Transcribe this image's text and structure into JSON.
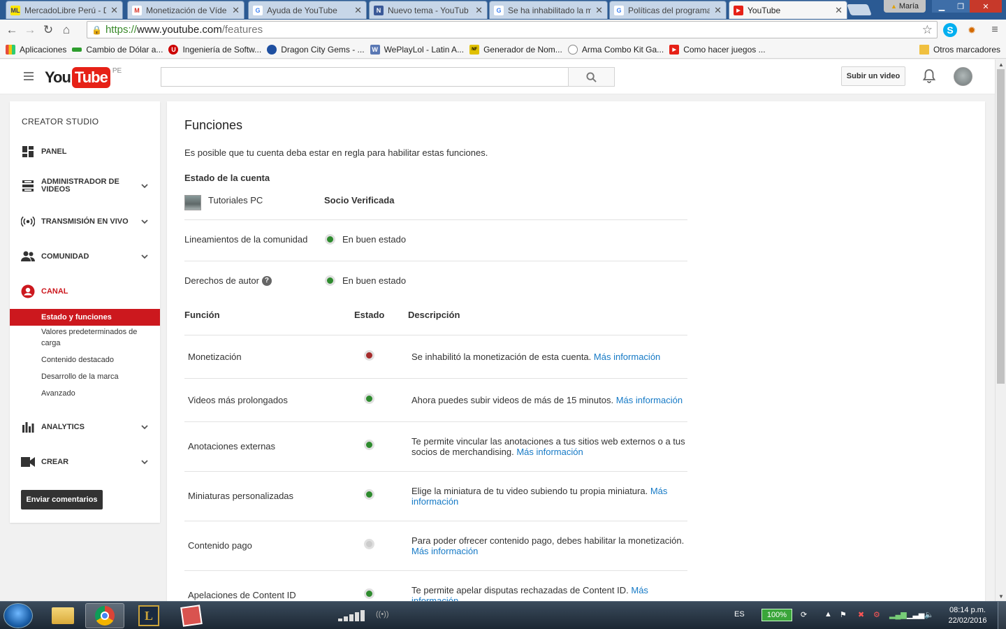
{
  "browser": {
    "user": "María",
    "tabs": [
      {
        "title": "MercadoLibre Perú - D",
        "fav_color": "#ffe600",
        "fav": "ML"
      },
      {
        "title": "Monetización de Víde",
        "fav_color": "#ffffff",
        "fav": "M"
      },
      {
        "title": "Ayuda de YouTube",
        "fav_color": "#ffffff",
        "fav": "G"
      },
      {
        "title": "Nuevo tema - YouTub",
        "fav_color": "#3b5998",
        "fav": "N"
      },
      {
        "title": "Se ha inhabilitado la m",
        "fav_color": "#ffffff",
        "fav": "G"
      },
      {
        "title": "Políticas del programa",
        "fav_color": "#ffffff",
        "fav": "G"
      },
      {
        "title": "YouTube",
        "fav_color": "#e62117",
        "fav": "▶"
      }
    ],
    "url_scheme": "https://",
    "url_domain": "www.youtube.com",
    "url_path": "/features",
    "bookmarks": [
      {
        "label": "Aplicaciones",
        "color": "#e74c3c"
      },
      {
        "label": "Cambio de Dólar a...",
        "color": "#2e9e2e"
      },
      {
        "label": "Ingeniería de Softw...",
        "color": "#cc0000"
      },
      {
        "label": "Dragon City Gems - ...",
        "color": "#1e4fa0"
      },
      {
        "label": "WePlayLol - Latin A...",
        "color": "#5a78b4"
      },
      {
        "label": "Generador de Nom...",
        "color": "#e0c000"
      },
      {
        "label": "Arma Combo Kit Ga...",
        "color": "#888888"
      },
      {
        "label": "Como hacer juegos ...",
        "color": "#e62117"
      }
    ],
    "other_bookmarks": "Otros marcadores"
  },
  "header": {
    "logo_you": "You",
    "logo_tube": "Tube",
    "country": "PE",
    "search_placeholder": "",
    "upload_label": "Subir un video"
  },
  "sidebar": {
    "title": "CREATOR STUDIO",
    "items": [
      {
        "label": "PANEL",
        "icon": "dashboard-icon"
      },
      {
        "label": "ADMINISTRADOR DE VIDEOS",
        "icon": "video-manager-icon"
      },
      {
        "label": "TRANSMISIÓN EN VIVO",
        "icon": "live-icon"
      },
      {
        "label": "COMUNIDAD",
        "icon": "community-icon"
      },
      {
        "label": "CANAL",
        "icon": "channel-icon"
      },
      {
        "label": "ANALYTICS",
        "icon": "analytics-icon"
      },
      {
        "label": "CREAR",
        "icon": "create-icon"
      }
    ],
    "channel_sub": [
      "Estado y funciones",
      "Valores predeterminados de carga",
      "Contenido destacado",
      "Desarrollo de la marca",
      "Avanzado"
    ],
    "feedback_label": "Enviar comentarios"
  },
  "main": {
    "title": "Funciones",
    "description": "Es posible que tu cuenta deba estar en regla para habilitar estas funciones.",
    "account_heading": "Estado de la cuenta",
    "account_name": "Tutoriales PC",
    "account_status": "Socio Verificada",
    "guidelines_label": "Lineamientos de la comunidad",
    "guidelines_status": "En buen estado",
    "copyright_label": "Derechos de autor",
    "copyright_status": "En buen estado",
    "col_function": "Función",
    "col_status": "Estado",
    "col_description": "Descripción",
    "more_info": "Más información",
    "features": [
      {
        "name": "Monetización",
        "status": "red",
        "desc": "Se inhabilitó la monetización de esta cuenta."
      },
      {
        "name": "Videos más prolongados",
        "status": "green",
        "desc": "Ahora puedes subir videos de más de 15 minutos."
      },
      {
        "name": "Anotaciones externas",
        "status": "green",
        "desc": "Te permite vincular las anotaciones a tus sitios web externos o a tus socios de merchandising."
      },
      {
        "name": "Miniaturas personalizadas",
        "status": "green",
        "desc": "Elige la miniatura de tu video subiendo tu propia miniatura."
      },
      {
        "name": "Contenido pago",
        "status": "gray",
        "desc": "Para poder ofrecer contenido pago, debes habilitar la monetización."
      },
      {
        "name": "Apelaciones de Content ID",
        "status": "green",
        "desc": "Te permite apelar disputas rechazadas de Content ID."
      }
    ]
  },
  "taskbar": {
    "lang": "ES",
    "battery": "100%",
    "time": "08:14 p.m.",
    "date": "22/02/2016"
  }
}
